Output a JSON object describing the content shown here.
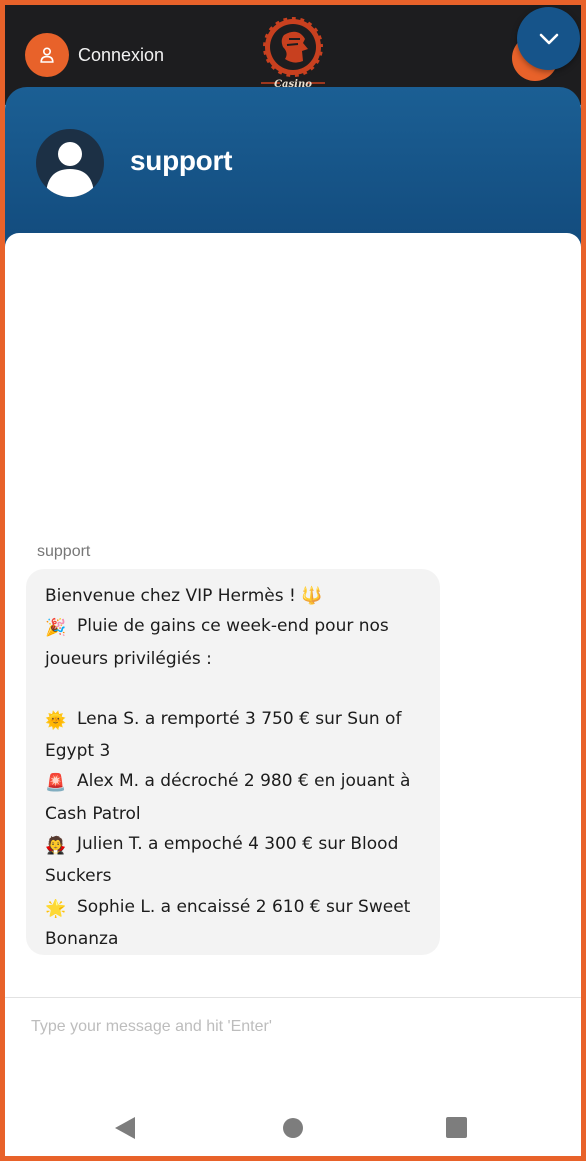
{
  "topbar": {
    "login_label": "Connexion",
    "logo_text": "Casino",
    "icons": {
      "login": "user-icon",
      "menu": "menu-icon",
      "collapse": "chevron-down-icon"
    }
  },
  "chat": {
    "agent_name": "support",
    "sender_label": "support",
    "message": {
      "line1": "Bienvenue chez VIP Hermès ! 🔱",
      "line2_emoji": "🎉",
      "line2": "Pluie de gains ce week-end pour nos",
      "line3": "joueurs privilégiés :",
      "line4_emoji": "🌞",
      "line4": "Lena S. a remporté 3 750 € sur Sun of",
      "line5": "Egypt 3",
      "line6_emoji": "🚨",
      "line6": "Alex M. a décroché 2 980 € en jouant à",
      "line7": "Cash Patrol",
      "line8_emoji": "🧛",
      "line8": "Julien T. a empoché 4 300 € sur Blood",
      "line9": "Suckers",
      "line10_emoji": "🌟",
      "line10": "Sophie L. a encaissé 2 610 € sur Sweet",
      "line11": "Bonanza"
    },
    "composer": {
      "placeholder": "Type your message and hit 'Enter'",
      "value": ""
    }
  },
  "colors": {
    "accent": "#e8622a",
    "header_blue": "#16548a",
    "topbar_dark": "#1d1d1f"
  },
  "navbar": {
    "icons": [
      "back-icon",
      "home-icon",
      "recent-apps-icon"
    ]
  }
}
